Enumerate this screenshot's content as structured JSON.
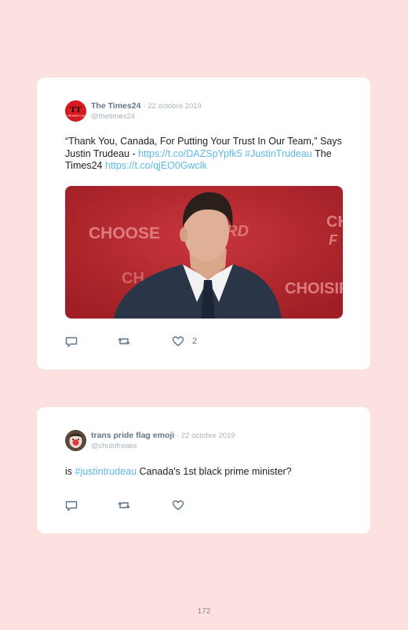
{
  "tweets": [
    {
      "name": "The Times24",
      "date": "· 22 octobre 2019",
      "handle": "@thetimes24",
      "avatar_text": "TT",
      "avatar_caption": "THETIMES24.COM",
      "text_parts": [
        {
          "t": "“Thank You, Canada, For Putting Your Trust In Our Team,” Says Justin Trudeau - ",
          "link": false
        },
        {
          "t": "https://t.co/DAZSpYpfk5",
          "link": true
        },
        {
          "t": " ",
          "link": false
        },
        {
          "t": "#JustinTrudeau",
          "link": true
        },
        {
          "t": " The Times24 ",
          "link": false
        },
        {
          "t": "https://t.co/qjEO0Gwclk",
          "link": true
        }
      ],
      "image": {
        "banner_choose": "CHOOSE",
        "banner_forward": "RD",
        "banner_ch": "CH",
        "banner_choisir": "CHOISIR",
        "banner_right": "CH",
        "banner_right2": "F"
      },
      "like_count": "2"
    },
    {
      "name": "trans pride flag emoji",
      "date": "· 22 octobre 2019",
      "handle": "@chulofreaks",
      "text_parts": [
        {
          "t": "is ",
          "link": false
        },
        {
          "t": "#justintrudeau",
          "link": true
        },
        {
          "t": " Canada's 1st black prime minister?",
          "link": false
        }
      ],
      "like_count": ""
    }
  ],
  "icons": {
    "reply": "reply-icon",
    "retweet": "retweet-icon",
    "like": "heart-icon"
  },
  "colors": {
    "link": "#5bb9e8",
    "background": "#fde0e0"
  },
  "page_number": "172"
}
